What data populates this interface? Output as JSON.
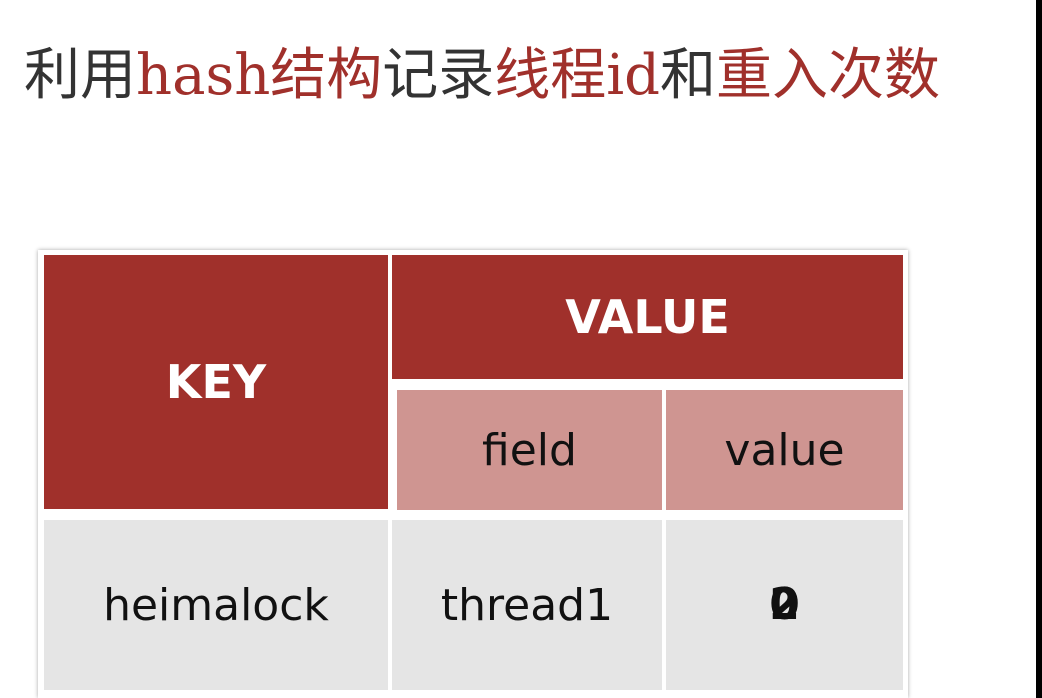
{
  "title": {
    "segments": [
      {
        "text": "利用",
        "highlight": false
      },
      {
        "text": "hash结构",
        "highlight": true
      },
      {
        "text": "记录",
        "highlight": false
      },
      {
        "text": "线程id",
        "highlight": true
      },
      {
        "text": "和",
        "highlight": false
      },
      {
        "text": "重入次数",
        "highlight": true
      }
    ]
  },
  "colors": {
    "accent_red": "#a0302b",
    "header_light": "#cf9591",
    "body_gray": "#e5e5e5",
    "title_text": "#333333"
  },
  "table": {
    "header": {
      "key": "KEY",
      "value": "VALUE",
      "field": "field",
      "value_sub": "value"
    },
    "rows": [
      {
        "key": "heimalock",
        "field": "thread1",
        "value_glyphs": [
          "0",
          "2"
        ]
      }
    ]
  }
}
